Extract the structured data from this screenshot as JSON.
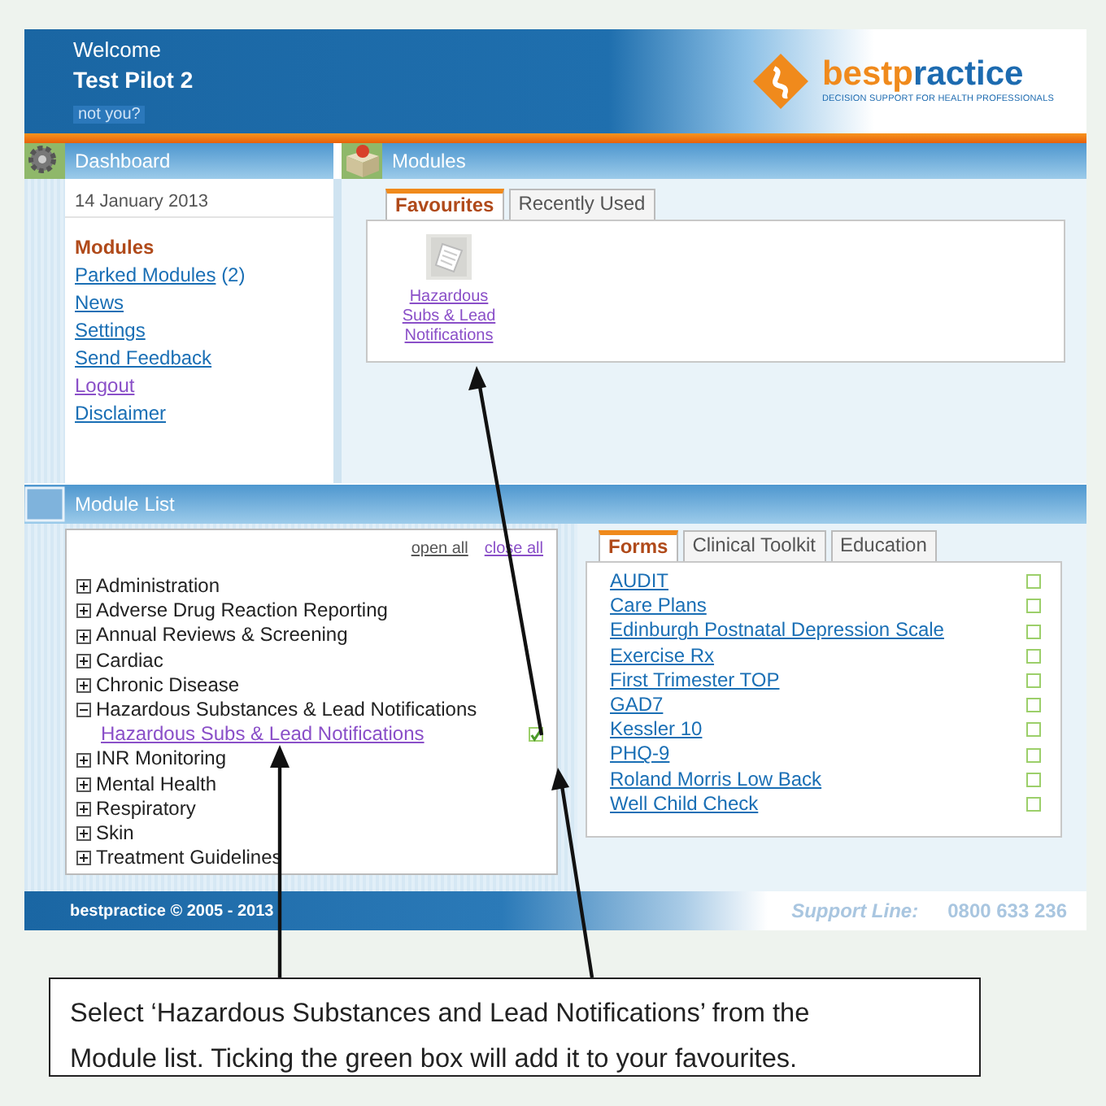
{
  "header": {
    "welcome": "Welcome",
    "user": "Test Pilot 2",
    "not_you": "not you?",
    "logo": {
      "brand": [
        "best",
        "practice"
      ],
      "tagline": "DECISION SUPPORT FOR HEALTH PROFESSIONALS"
    }
  },
  "dashboard": {
    "title": "Dashboard",
    "date": "14 January 2013",
    "links": [
      {
        "text": "Modules",
        "kind": "current"
      },
      {
        "text": "Parked Modules",
        "count": "(2)",
        "kind": "link",
        "visited": false
      },
      {
        "text": "News",
        "kind": "link",
        "visited": false
      },
      {
        "text": "Settings",
        "kind": "link",
        "visited": false
      },
      {
        "text": "Send Feedback",
        "kind": "link",
        "visited": false
      },
      {
        "text": "Logout",
        "kind": "link",
        "visited": true
      },
      {
        "text": "Disclaimer",
        "kind": "link",
        "visited": false
      }
    ]
  },
  "modules": {
    "title": "Modules",
    "tabs": [
      {
        "label": "Favourites",
        "selected": true
      },
      {
        "label": "Recently Used",
        "selected": false
      }
    ],
    "favourites": [
      {
        "label": "Hazardous Subs & Lead Notifications"
      }
    ]
  },
  "module_list": {
    "title": "Module List",
    "actions": [
      {
        "label": "open all",
        "visited": false
      },
      {
        "label": "close all",
        "visited": true
      }
    ],
    "tree": [
      {
        "label": "Administration",
        "expanded": false
      },
      {
        "label": "Adverse Drug Reaction Reporting",
        "expanded": false
      },
      {
        "label": "Annual Reviews & Screening",
        "expanded": false
      },
      {
        "label": "Cardiac",
        "expanded": false
      },
      {
        "label": "Chronic Disease",
        "expanded": false
      },
      {
        "label": "Hazardous Substances & Lead Notifications",
        "expanded": true,
        "children": [
          {
            "label": "Hazardous Subs & Lead Notifications",
            "favourite": true
          }
        ]
      },
      {
        "label": "INR Monitoring",
        "expanded": false
      },
      {
        "label": "Mental Health",
        "expanded": false
      },
      {
        "label": "Respiratory",
        "expanded": false
      },
      {
        "label": "Skin",
        "expanded": false
      },
      {
        "label": "Treatment Guidelines",
        "expanded": false
      }
    ],
    "tabs": [
      {
        "label": "Forms",
        "selected": true
      },
      {
        "label": "Clinical Toolkit",
        "selected": false
      },
      {
        "label": "Education",
        "selected": false
      }
    ],
    "forms": [
      {
        "label": "AUDIT",
        "favourite": false
      },
      {
        "label": "Care Plans",
        "favourite": false
      },
      {
        "label": "Edinburgh Postnatal Depression Scale",
        "favourite": false
      },
      {
        "label": "Exercise Rx",
        "favourite": false
      },
      {
        "label": "First Trimester TOP",
        "favourite": false
      },
      {
        "label": "GAD7",
        "favourite": false
      },
      {
        "label": "Kessler 10",
        "favourite": false
      },
      {
        "label": "PHQ-9",
        "favourite": false
      },
      {
        "label": "Roland Morris Low Back",
        "favourite": false
      },
      {
        "label": "Well Child Check",
        "favourite": false
      }
    ]
  },
  "footer": {
    "copyright": "bestpractice © 2005 - 2013",
    "support_label": "Support Line:",
    "support_number": "0800 633 236"
  },
  "callout": {
    "text": "Select ‘Hazardous Substances and Lead Notifications’ from the Module list. Ticking the green box will add it to your favourites."
  }
}
